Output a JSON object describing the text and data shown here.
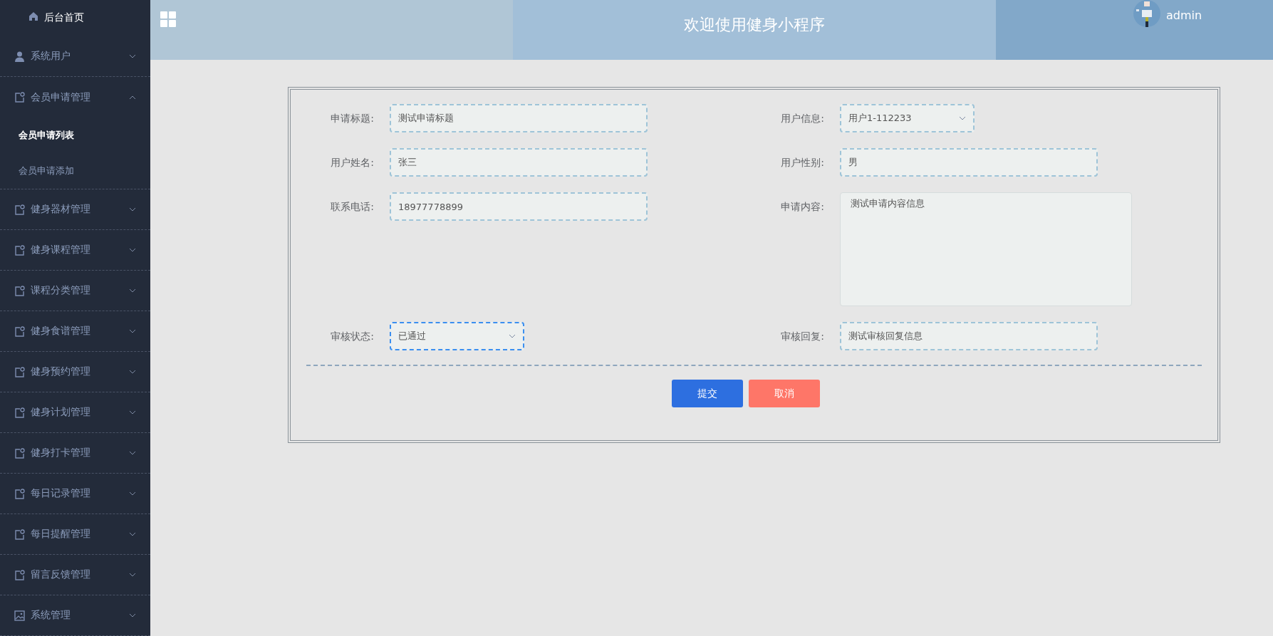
{
  "sidebar": {
    "home": "后台首页",
    "items": [
      {
        "label": "系统用户",
        "expanded": false
      },
      {
        "label": "会员申请管理",
        "expanded": true,
        "children": [
          {
            "label": "会员申请列表",
            "selected": true
          },
          {
            "label": "会员申请添加",
            "selected": false
          }
        ]
      },
      {
        "label": "健身器材管理",
        "expanded": false
      },
      {
        "label": "健身课程管理",
        "expanded": false
      },
      {
        "label": "课程分类管理",
        "expanded": false
      },
      {
        "label": "健身食谱管理",
        "expanded": false
      },
      {
        "label": "健身预约管理",
        "expanded": false
      },
      {
        "label": "健身计划管理",
        "expanded": false
      },
      {
        "label": "健身打卡管理",
        "expanded": false
      },
      {
        "label": "每日记录管理",
        "expanded": false
      },
      {
        "label": "每日提醒管理",
        "expanded": false
      },
      {
        "label": "留言反馈管理",
        "expanded": false
      },
      {
        "label": "系统管理",
        "expanded": false
      }
    ]
  },
  "header": {
    "title": "欢迎使用健身小程序",
    "user": "admin"
  },
  "form": {
    "fields": [
      {
        "label": "申请标题:",
        "kind": "input",
        "value": "测试申请标题",
        "focused": false
      },
      {
        "label": "用户信息:",
        "kind": "select",
        "value": "用户1-112233",
        "focused": false
      },
      {
        "label": "用户姓名:",
        "kind": "input",
        "value": "张三",
        "focused": false
      },
      {
        "label": "用户性别:",
        "kind": "input",
        "value": "男",
        "focused": false
      },
      {
        "label": "联系电话:",
        "kind": "input",
        "value": "18977778899",
        "focused": false
      },
      {
        "label": "申请内容:",
        "kind": "textarea",
        "value": "测试申请内容信息",
        "focused": false
      },
      {
        "label": "审核状态:",
        "kind": "select",
        "value": "已通过",
        "focused": true
      },
      {
        "label": "审核回复:",
        "kind": "input",
        "value": "测试审核回复信息",
        "focused": false
      }
    ],
    "buttons": [
      {
        "label": "提交",
        "kind": "primary"
      },
      {
        "label": "取消",
        "kind": "danger"
      }
    ]
  }
}
